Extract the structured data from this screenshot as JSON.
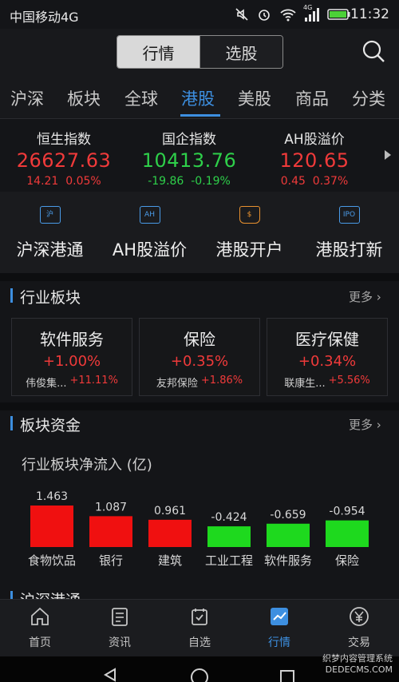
{
  "status_bar": {
    "carrier": "中国移动4G",
    "time": "11:32",
    "net": "4G"
  },
  "header": {
    "seg_active": "行情",
    "seg_inactive": "选股"
  },
  "tabs": [
    "沪深",
    "板块",
    "全球",
    "港股",
    "美股",
    "商品",
    "分类"
  ],
  "active_tab": "港股",
  "indices": [
    {
      "name": "恒生指数",
      "value": "26627.63",
      "change": "14.21",
      "pct": "0.05%",
      "dir": "up"
    },
    {
      "name": "国企指数",
      "value": "10413.76",
      "change": "-19.86",
      "pct": "-0.19%",
      "dir": "down"
    },
    {
      "name": "AH股溢价",
      "value": "120.65",
      "change": "0.45",
      "pct": "0.37%",
      "dir": "up"
    }
  ],
  "quick_nav": [
    {
      "label": "沪深港通",
      "icon": "沪"
    },
    {
      "label": "AH股溢价",
      "icon": "AH"
    },
    {
      "label": "港股开户",
      "icon": "$"
    },
    {
      "label": "港股打新",
      "icon": "IPO"
    }
  ],
  "industry": {
    "title": "行业板块",
    "more": "更多",
    "cards": [
      {
        "name": "软件服务",
        "pct": "+1.00%",
        "stock": "伟俊集...",
        "stock_pct": "+11.11%"
      },
      {
        "name": "保险",
        "pct": "+0.35%",
        "stock": "友邦保险",
        "stock_pct": "+1.86%"
      },
      {
        "name": "医疗保健",
        "pct": "+0.34%",
        "stock": "联康生...",
        "stock_pct": "+5.56%"
      }
    ]
  },
  "funds": {
    "title": "板块资金",
    "more": "更多",
    "chart_title": "行业板块净流入 (亿)"
  },
  "chart_data": {
    "type": "bar",
    "title": "行业板块净流入 (亿)",
    "categories": [
      "食物饮品",
      "银行",
      "建筑",
      "工业工程",
      "软件服务",
      "保险"
    ],
    "values": [
      1.463,
      1.087,
      0.961,
      -0.424,
      -0.659,
      -0.954
    ],
    "value_labels": [
      "1.463",
      "1.087",
      "0.961",
      "-0.424",
      "-0.659",
      "-0.954"
    ],
    "colors": {
      "positive": "#f01010",
      "negative": "#1ed91e"
    }
  },
  "next_section": "沪深港通",
  "bottom_tabs": [
    {
      "label": "首页",
      "icon": "home-icon"
    },
    {
      "label": "资讯",
      "icon": "news-icon"
    },
    {
      "label": "自选",
      "icon": "watchlist-icon"
    },
    {
      "label": "行情",
      "icon": "market-icon"
    },
    {
      "label": "交易",
      "icon": "yen-icon"
    }
  ],
  "active_bottom_tab": "行情",
  "watermark": {
    "line1": "织梦内容管理系统",
    "line2": "DEDECMS.COM"
  },
  "colors": {
    "accent": "#3d8fe0",
    "up": "#f03a3a",
    "down": "#2ecf4a",
    "background": "#141518"
  }
}
